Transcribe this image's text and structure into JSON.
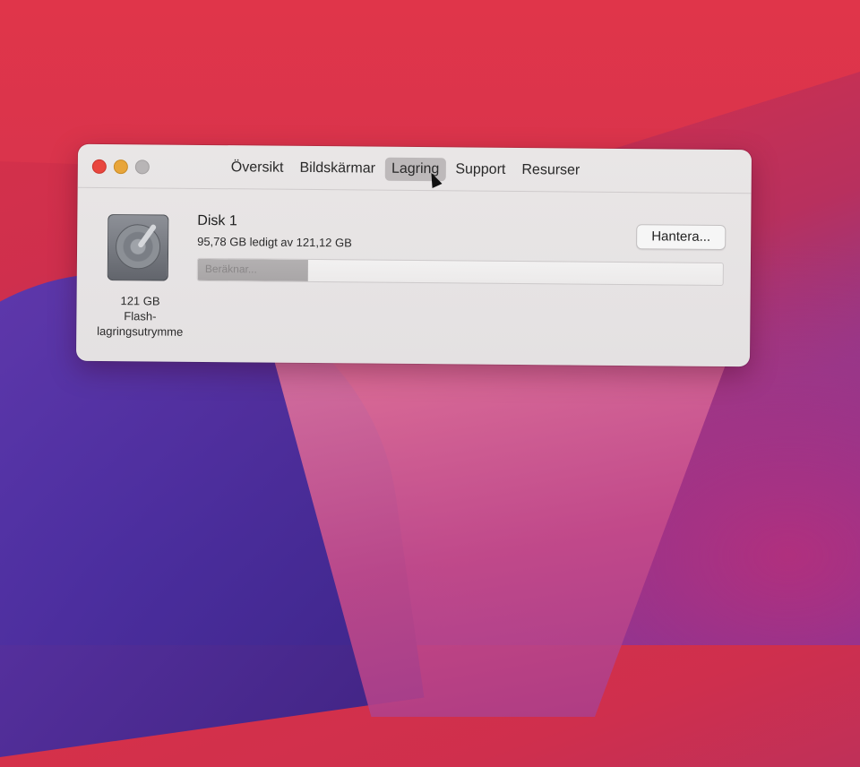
{
  "window": {
    "tabs": [
      {
        "label": "Översikt",
        "active": false
      },
      {
        "label": "Bildskärmar",
        "active": false
      },
      {
        "label": "Lagring",
        "active": true
      },
      {
        "label": "Support",
        "active": false
      },
      {
        "label": "Resurser",
        "active": false
      }
    ],
    "traffic_light_colors": {
      "close": "#e9463e",
      "minimize": "#e8a53a",
      "maximize": "#b8b5b6"
    }
  },
  "storage": {
    "disk_name": "Disk 1",
    "free_text": "95,78 GB ledigt av 121,12 GB",
    "capacity_caption": "121 GB",
    "type_caption_1": "Flash-",
    "type_caption_2": "lagringsutrymme",
    "manage_button_label": "Hantera...",
    "progress_label": "Beräknar...",
    "progress_fraction": 0.21,
    "disk_icon": "hard-disk-icon"
  }
}
